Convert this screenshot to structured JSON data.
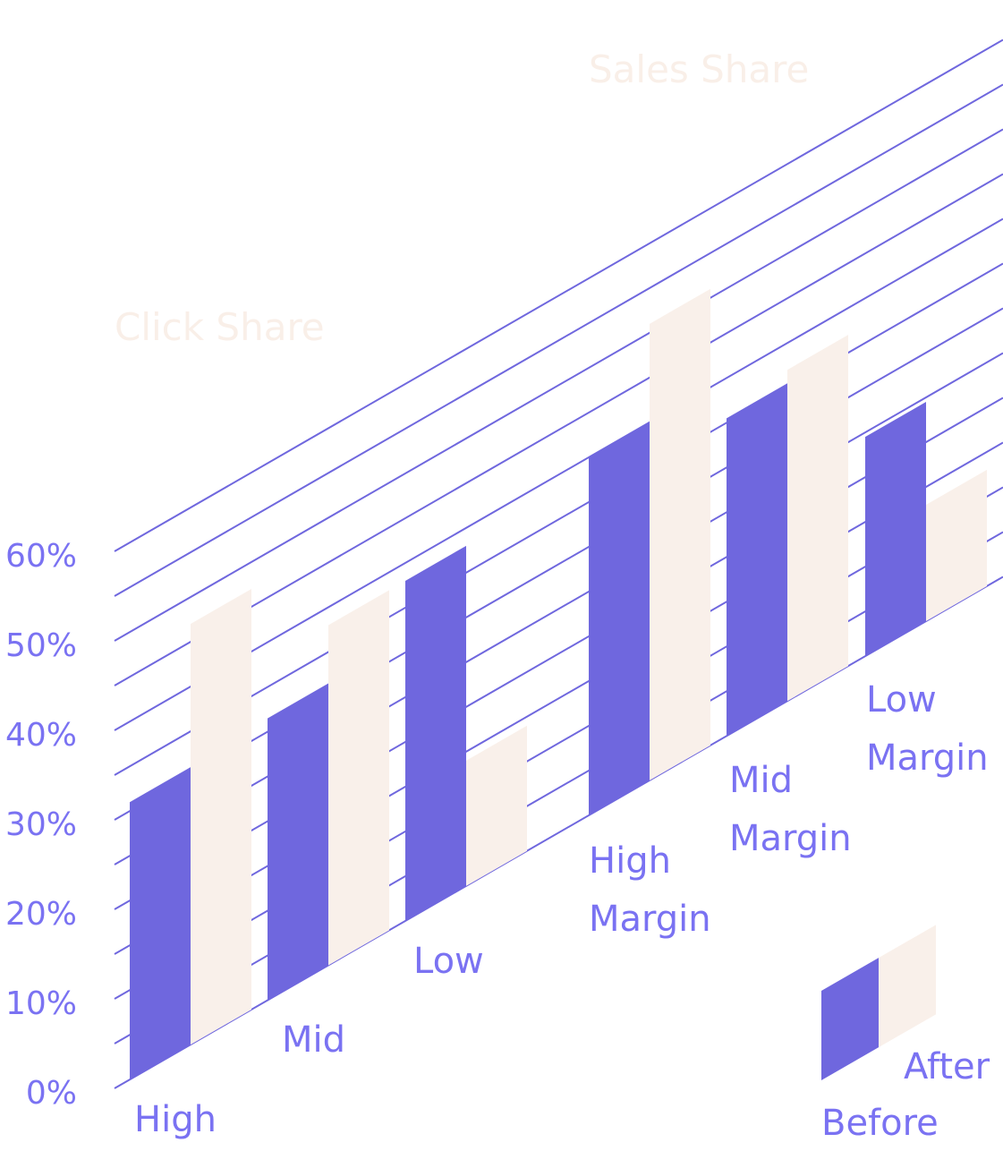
{
  "chart_data": {
    "type": "bar",
    "style": "isometric-grouped",
    "yaxis": {
      "ylim": [
        0,
        60
      ],
      "tick_labels": [
        "0%",
        "10%",
        "20%",
        "30%",
        "40%",
        "50%",
        "60%"
      ],
      "tick_values": [
        0,
        10,
        20,
        30,
        40,
        50,
        60
      ],
      "minor_step": 5,
      "grid": true
    },
    "series": [
      {
        "name": "Before",
        "color": "#6f67de"
      },
      {
        "name": "After",
        "color": "#f9f0ea"
      }
    ],
    "panels": [
      {
        "title": "Click Share",
        "categories": [
          "High",
          "Mid",
          "Low"
        ],
        "values": {
          "Before": [
            31,
            31.5,
            38
          ],
          "After": [
            47,
            38,
            14
          ]
        }
      },
      {
        "title": "Sales Share",
        "categories": [
          "High Margin",
          "Mid Margin",
          "Low Margin"
        ],
        "values": {
          "Before": [
            40,
            35.5,
            24.5
          ],
          "After": [
            51,
            37,
            13
          ]
        }
      }
    ],
    "legend": {
      "placement": "bottom-right",
      "entries": [
        "Before",
        "After"
      ]
    },
    "colors": {
      "grid": "#6f67de",
      "text": "#7a72f2",
      "title": "#f9efe8"
    }
  }
}
